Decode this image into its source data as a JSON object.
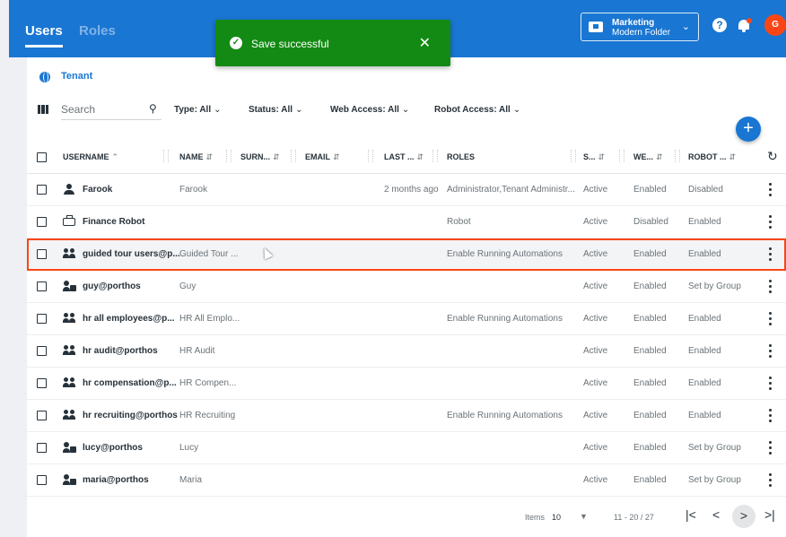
{
  "header": {
    "tabs": [
      {
        "label": "Users"
      },
      {
        "label": "Roles"
      }
    ],
    "folder": {
      "name": "Marketing",
      "sub": "Modern Folder"
    },
    "help": "?",
    "avatar_initial": "G"
  },
  "toast": {
    "message": "Save successful",
    "close": "✕",
    "color": "#138a13"
  },
  "tenant": {
    "label": "Tenant"
  },
  "filters": {
    "search_placeholder": "Search",
    "items": [
      {
        "label": "Type: All"
      },
      {
        "label": "Status: All"
      },
      {
        "label": "Web Access: All"
      },
      {
        "label": "Robot Access: All"
      }
    ]
  },
  "add_label": "+",
  "table": {
    "columns": {
      "username": "USERNAME",
      "name": "NAME",
      "surname": "SURN...",
      "email": "EMAIL",
      "last": "LAST ...",
      "roles": "ROLES",
      "status": "S...",
      "web": "WE...",
      "robot": "ROBOT ..."
    },
    "rows": [
      {
        "icon": "user-icon",
        "username": "Farook",
        "name": "Farook",
        "last": "2 months ago",
        "roles": "Administrator,Tenant Administr...",
        "status": "Active",
        "web": "Enabled",
        "robot": "Disabled"
      },
      {
        "icon": "robot-icon",
        "username": "Finance Robot",
        "name": "",
        "last": "",
        "roles": "Robot",
        "status": "Active",
        "web": "Disabled",
        "robot": "Enabled"
      },
      {
        "icon": "group-icon",
        "username": "guided tour users@p...",
        "name": "Guided Tour ...",
        "last": "",
        "roles": "Enable Running Automations",
        "status": "Active",
        "web": "Enabled",
        "robot": "Enabled",
        "selected": true
      },
      {
        "icon": "directory-user-icon",
        "username": "guy@porthos",
        "name": "Guy",
        "last": "",
        "roles": "",
        "status": "Active",
        "web": "Enabled",
        "robot": "Set by Group"
      },
      {
        "icon": "group-icon",
        "username": "hr all employees@p...",
        "name": "HR All Emplo...",
        "last": "",
        "roles": "Enable Running Automations",
        "status": "Active",
        "web": "Enabled",
        "robot": "Enabled"
      },
      {
        "icon": "group-icon",
        "username": "hr audit@porthos",
        "name": "HR Audit",
        "last": "",
        "roles": "",
        "status": "Active",
        "web": "Enabled",
        "robot": "Enabled"
      },
      {
        "icon": "group-icon",
        "username": "hr compensation@p...",
        "name": "HR Compen...",
        "last": "",
        "roles": "",
        "status": "Active",
        "web": "Enabled",
        "robot": "Enabled"
      },
      {
        "icon": "group-icon",
        "username": "hr recruiting@porthos",
        "name": "HR Recruiting",
        "last": "",
        "roles": "Enable Running Automations",
        "status": "Active",
        "web": "Enabled",
        "robot": "Enabled"
      },
      {
        "icon": "directory-user-icon",
        "username": "lucy@porthos",
        "name": "Lucy",
        "last": "",
        "roles": "",
        "status": "Active",
        "web": "Enabled",
        "robot": "Set by Group"
      },
      {
        "icon": "directory-user-icon",
        "username": "maria@porthos",
        "name": "Maria",
        "last": "",
        "roles": "",
        "status": "Active",
        "web": "Enabled",
        "robot": "Set by Group"
      }
    ]
  },
  "footer": {
    "items_label": "Items",
    "items_per_page": "10",
    "range": "11 - 20 / 27"
  },
  "colors": {
    "primary": "#1976d2",
    "accent": "#fa4616",
    "success": "#138a13"
  }
}
